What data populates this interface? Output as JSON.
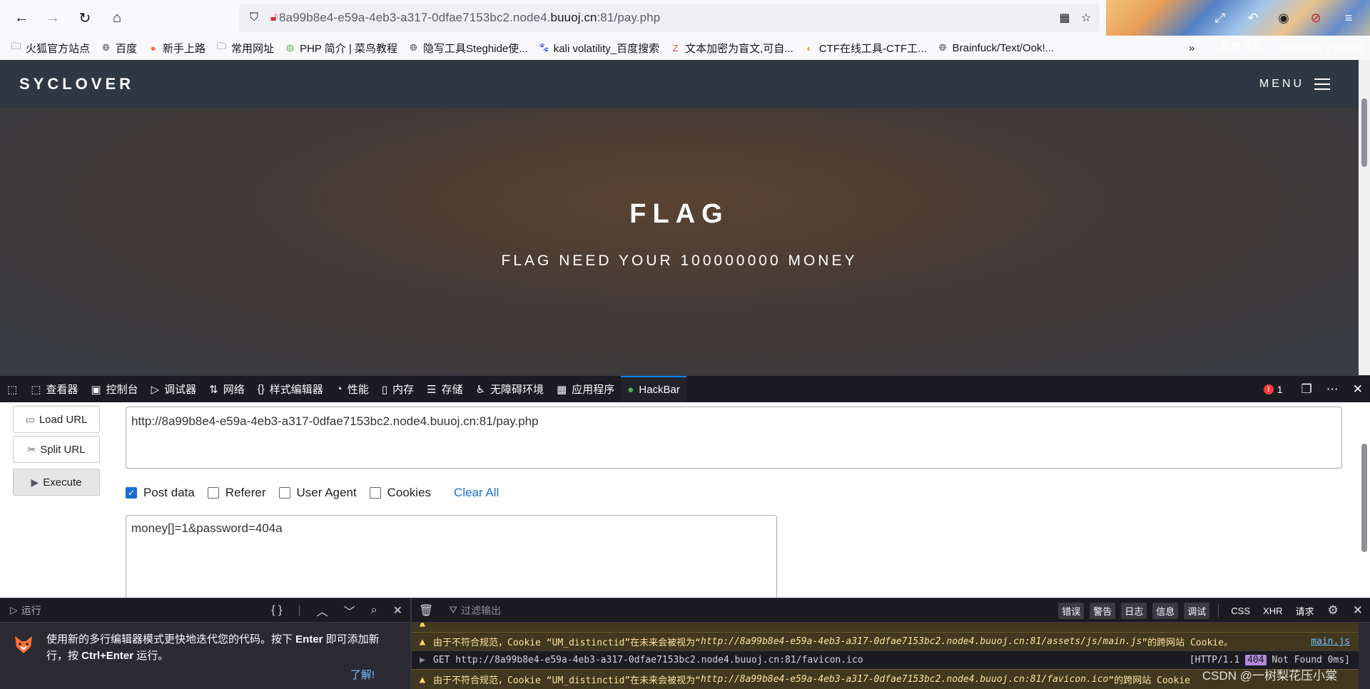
{
  "browser": {
    "url": {
      "prefix": "8a99b8e4-e59a-4eb3-a317-0dfae7153bc2.node4.",
      "host": "buuoj.cn",
      "suffix": ":81/pay.php"
    },
    "bookmarks": [
      {
        "label": "火狐官方站点",
        "icon": "folder-icon"
      },
      {
        "label": "百度",
        "icon": "globe-icon"
      },
      {
        "label": "新手上路",
        "icon": "firefox-icon"
      },
      {
        "label": "常用网址",
        "icon": "folder-icon"
      },
      {
        "label": "PHP 简介 | 菜鸟教程",
        "icon": "runoob-icon"
      },
      {
        "label": "隐写工具Steghide使...",
        "icon": "globe-icon"
      },
      {
        "label": "kali volatility_百度搜索",
        "icon": "baidu-icon"
      },
      {
        "label": "文本加密为盲文,可自...",
        "icon": "zi-icon"
      },
      {
        "label": "CTF在线工具-CTF工...",
        "icon": "ctf-icon"
      },
      {
        "label": "Brainfuck/Text/Ook!...",
        "icon": "globe-icon"
      }
    ],
    "bookmarks_overflow": "»",
    "other_bookmarks": "其他书签",
    "mobile_bookmarks": "移动设备上的书签"
  },
  "site": {
    "logo": "SYCLOVER",
    "menu_label": "MENU",
    "hero_title": "FLAG",
    "hero_subtitle": "FLAG NEED YOUR 100000000 MONEY"
  },
  "devtools": {
    "tabs": [
      {
        "label": "查看器",
        "icon": "inspector-icon"
      },
      {
        "label": "控制台",
        "icon": "console-icon"
      },
      {
        "label": "调试器",
        "icon": "debugger-icon"
      },
      {
        "label": "网络",
        "icon": "network-icon"
      },
      {
        "label": "样式编辑器",
        "icon": "style-editor-icon"
      },
      {
        "label": "性能",
        "icon": "performance-icon"
      },
      {
        "label": "内存",
        "icon": "memory-icon"
      },
      {
        "label": "存储",
        "icon": "storage-icon"
      },
      {
        "label": "无障碍环境",
        "icon": "accessibility-icon"
      },
      {
        "label": "应用程序",
        "icon": "application-icon"
      },
      {
        "label": "HackBar",
        "icon": "hackbar-icon"
      }
    ],
    "error_count": "1"
  },
  "hackbar": {
    "load_url": "Load URL",
    "split_url": "Split URL",
    "execute": "Execute",
    "url_value": "http://8a99b8e4-e59a-4eb3-a317-0dfae7153bc2.node4.buuoj.cn:81/pay.php",
    "options": [
      {
        "label": "Post data",
        "checked": true
      },
      {
        "label": "Referer",
        "checked": false
      },
      {
        "label": "User Agent",
        "checked": false
      },
      {
        "label": "Cookies",
        "checked": false
      }
    ],
    "clear_all": "Clear All",
    "post_value": "money[]=1&password=404a"
  },
  "console": {
    "run_label": "运行",
    "braces": "{ }",
    "tip_line1_a": "使用新的多行编辑器模式更快地迭代您的代码。按下 ",
    "tip_line1_b": "Enter",
    "tip_line1_c": " 即可添加新",
    "tip_line2_a": "行，按 ",
    "tip_line2_b": "Ctrl+Enter",
    "tip_line2_c": " 运行。",
    "tip_link": "了解!",
    "filter_placeholder": "过滤输出",
    "filters": [
      "错误",
      "警告",
      "日志",
      "信息",
      "调试"
    ],
    "filters_plain": [
      "CSS",
      "XHR",
      "请求"
    ],
    "log1_a": "由于不符合规范，Cookie “UM_distinctid”在未来会被视为“",
    "log1_url": "http://8a99b8e4-e59a-4eb3-a317-0dfae7153bc2.node4.buuoj.cn:81/assets/js/main.js",
    "log1_b": "”的跨网站 Cookie。",
    "log1_src": "main.js",
    "log2": "GET http://8a99b8e4-e59a-4eb3-a317-0dfae7153bc2.node4.buuoj.cn:81/favicon.ico",
    "log2_status_a": "[HTTP/1.1 ",
    "log2_status_code": "404",
    "log2_status_b": " Not Found 0ms]",
    "log3_a": "由于不符合规范，Cookie “UM_distinctid”在未来会被视为“",
    "log3_url": "http://8a99b8e4-e59a-4eb3-a317-0dfae7153bc2.node4.buuoj.cn:81/favicon.ico",
    "log3_b": "”的跨网站 Cookie",
    "watermark": "CSDN @一树梨花压小棠"
  }
}
